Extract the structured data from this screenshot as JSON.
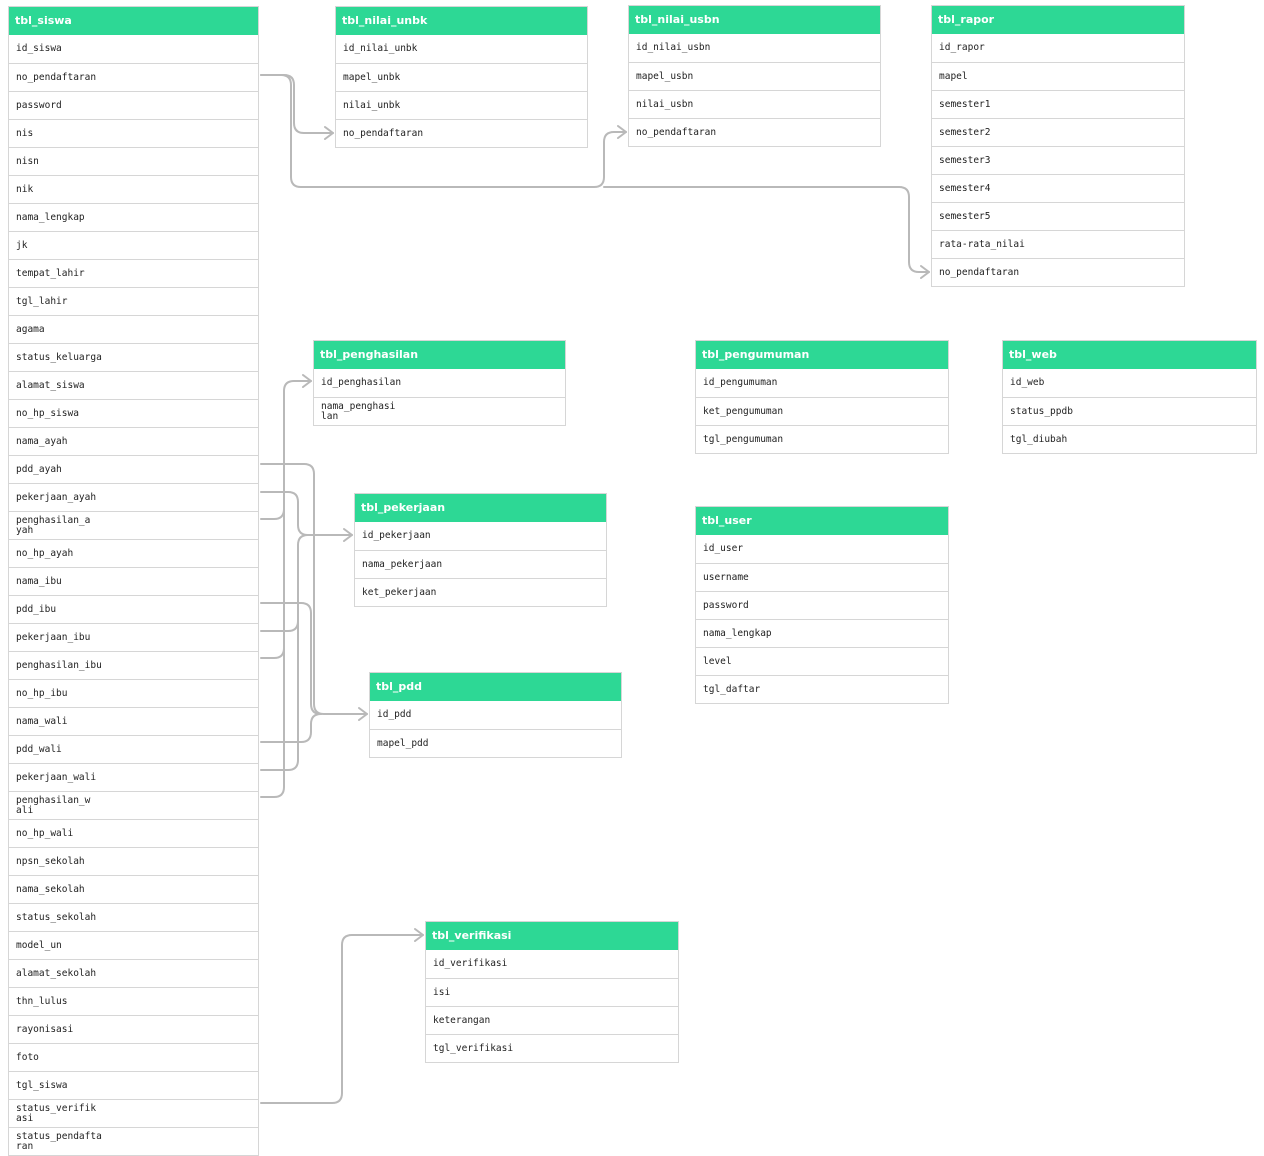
{
  "colors": {
    "header": "#2dd895",
    "line": "#b9b9b9",
    "border": "#d6d6d6"
  },
  "tables": {
    "siswa": {
      "name": "tbl_siswa",
      "fields": [
        "id_siswa",
        "no_pendaftaran",
        "password",
        "nis",
        "nisn",
        "nik",
        "nama_lengkap",
        "jk",
        "tempat_lahir",
        "tgl_lahir",
        "agama",
        "status_keluarga",
        "alamat_siswa",
        "no_hp_siswa",
        "nama_ayah",
        "pdd_ayah",
        "pekerjaan_ayah",
        "penghasilan_a\nyah",
        "no_hp_ayah",
        "nama_ibu",
        "pdd_ibu",
        "pekerjaan_ibu",
        "penghasilan_ibu",
        "no_hp_ibu",
        "nama_wali",
        "pdd_wali",
        "pekerjaan_wali",
        "penghasilan_w\nali",
        "no_hp_wali",
        "npsn_sekolah",
        "nama_sekolah",
        "status_sekolah",
        "model_un",
        "alamat_sekolah",
        "thn_lulus",
        "rayonisasi",
        "foto",
        "tgl_siswa",
        "status_verifik\nasi",
        "status_pendafta\nran"
      ]
    },
    "nilai_unbk": {
      "name": "tbl_nilai_unbk",
      "fields": [
        "id_nilai_unbk",
        "mapel_unbk",
        "nilai_unbk",
        "no_pendaftaran"
      ]
    },
    "nilai_usbn": {
      "name": "tbl_nilai_usbn",
      "fields": [
        "id_nilai_usbn",
        "mapel_usbn",
        "nilai_usbn",
        "no_pendaftaran"
      ]
    },
    "rapor": {
      "name": "tbl_rapor",
      "fields": [
        "id_rapor",
        "mapel",
        "semester1",
        "semester2",
        "semester3",
        "semester4",
        "semester5",
        "rata-rata_nilai",
        "no_pendaftaran"
      ]
    },
    "penghasilan": {
      "name": "tbl_penghasilan",
      "fields": [
        "id_penghasilan",
        "nama_penghasi\nlan"
      ]
    },
    "pengumuman": {
      "name": "tbl_pengumuman",
      "fields": [
        "id_pengumuman",
        "ket_pengumuman",
        "tgl_pengumuman"
      ]
    },
    "web": {
      "name": "tbl_web",
      "fields": [
        "id_web",
        "status_ppdb",
        "tgl_diubah"
      ]
    },
    "pekerjaan": {
      "name": "tbl_pekerjaan",
      "fields": [
        "id_pekerjaan",
        "nama_pekerjaan",
        "ket_pekerjaan"
      ]
    },
    "user": {
      "name": "tbl_user",
      "fields": [
        "id_user",
        "username",
        "password",
        "nama_lengkap",
        "level",
        "tgl_daftar"
      ]
    },
    "pdd": {
      "name": "tbl_pdd",
      "fields": [
        "id_pdd",
        "mapel_pdd"
      ]
    },
    "verifikasi": {
      "name": "tbl_verifikasi",
      "fields": [
        "id_verifikasi",
        "isi",
        "keterangan",
        "tgl_verifikasi"
      ]
    }
  },
  "relations": [
    {
      "from": "siswa.no_pendaftaran",
      "to": "nilai_unbk.no_pendaftaran"
    },
    {
      "from": "siswa.no_pendaftaran",
      "to": "nilai_usbn.no_pendaftaran"
    },
    {
      "from": "siswa.no_pendaftaran",
      "to": "rapor.no_pendaftaran"
    },
    {
      "from": "siswa.penghasilan_ayah",
      "to": "penghasilan.id_penghasilan"
    },
    {
      "from": "siswa.penghasilan_ibu",
      "to": "penghasilan.id_penghasilan"
    },
    {
      "from": "siswa.penghasilan_wali",
      "to": "penghasilan.id_penghasilan"
    },
    {
      "from": "siswa.pekerjaan_ayah",
      "to": "pekerjaan.id_pekerjaan"
    },
    {
      "from": "siswa.pekerjaan_ibu",
      "to": "pekerjaan.id_pekerjaan"
    },
    {
      "from": "siswa.pekerjaan_wali",
      "to": "pekerjaan.id_pekerjaan"
    },
    {
      "from": "siswa.pdd_ayah",
      "to": "pdd.id_pdd"
    },
    {
      "from": "siswa.pdd_ibu",
      "to": "pdd.id_pdd"
    },
    {
      "from": "siswa.pdd_wali",
      "to": "pdd.id_pdd"
    },
    {
      "from": "siswa.status_verifikasi",
      "to": "verifikasi.id_verifikasi"
    }
  ]
}
